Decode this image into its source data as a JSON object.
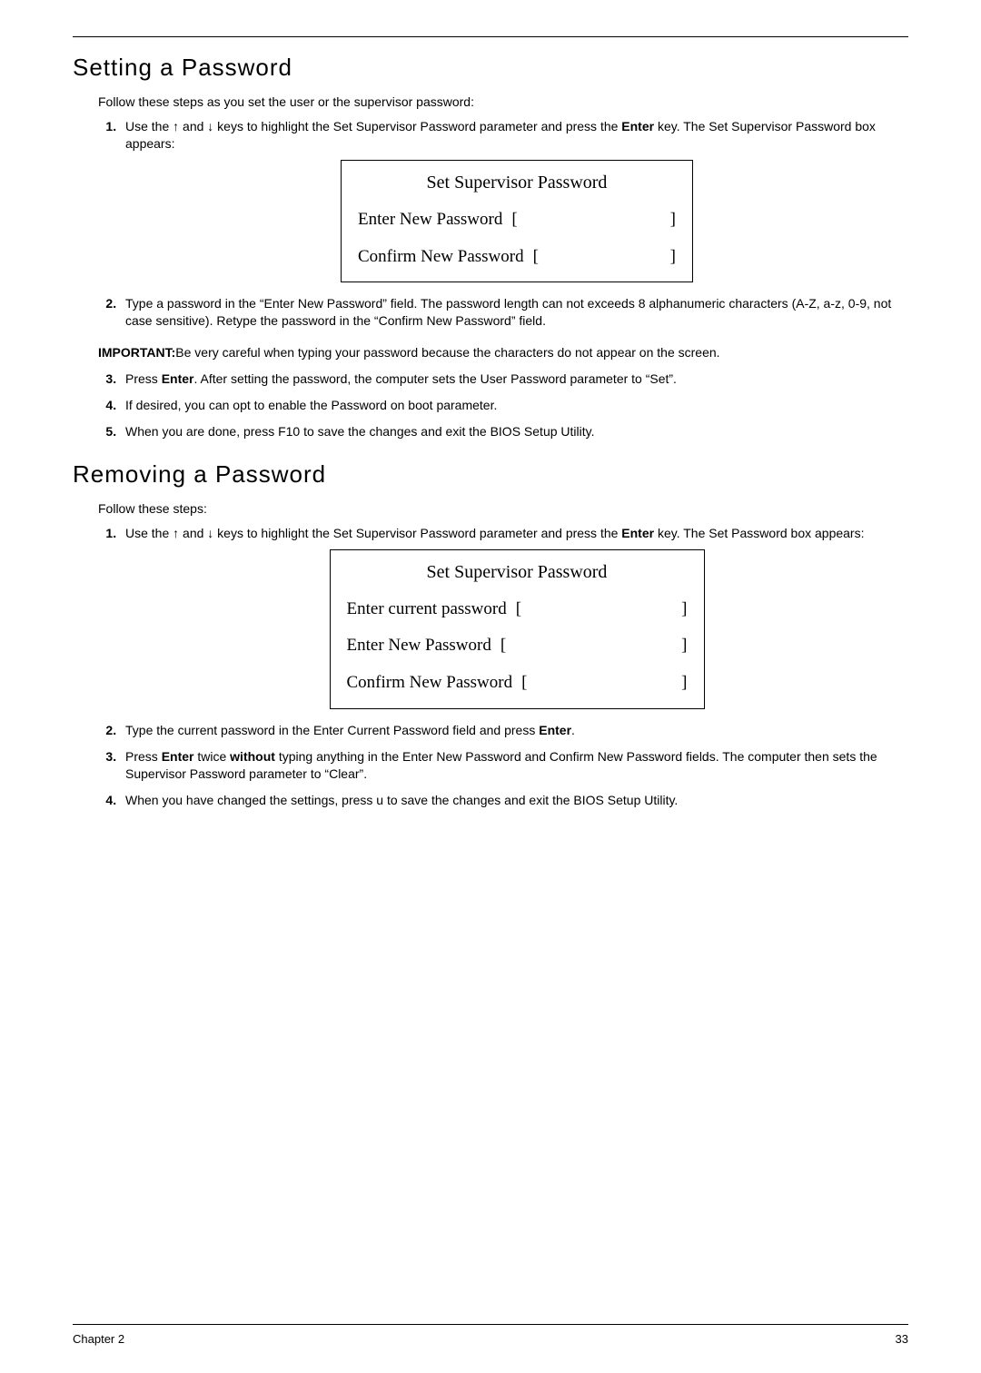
{
  "section1": {
    "heading": "Setting a Password",
    "intro": "Follow these steps as you set the user or the supervisor password:",
    "step1_a": "Use the ",
    "step1_b": " and ",
    "step1_c": " keys to highlight the Set Supervisor Password parameter and press the ",
    "step1_key": "Enter",
    "step1_d": " key. The Set Supervisor Password box appears:",
    "bios": {
      "title": "Set Supervisor Password",
      "row1": "Enter New Password",
      "row2": "Confirm New Password",
      "lb": "[",
      "rb": "]"
    },
    "step2": "Type a password in the “Enter New Password” field. The password length can not exceeds 8 alphanumeric characters (A-Z, a-z, 0-9, not case sensitive). Retype the password in the “Confirm New Password” field.",
    "important_lbl": "IMPORTANT:",
    "important_txt": "Be very careful when typing your password because the characters do not appear on the screen.",
    "step3_a": "Press ",
    "step3_key": "Enter",
    "step3_b": ". After setting the password, the computer sets the User Password parameter to “Set”.",
    "step4": "If desired, you can opt to enable the Password on boot parameter.",
    "step5": "When you are done, press F10 to save the changes and exit the BIOS Setup Utility."
  },
  "section2": {
    "heading": "Removing a Password",
    "intro": "Follow these steps:",
    "step1_a": "Use the ",
    "step1_b": " and ",
    "step1_c": " keys to highlight the Set Supervisor Password parameter and press the ",
    "step1_key": "Enter",
    "step1_d": " key. The Set Password box appears:",
    "bios": {
      "title": "Set Supervisor Password",
      "row1": "Enter current password",
      "row2": "Enter New Password",
      "row3": "Confirm New Password",
      "lb": "[",
      "rb": "]"
    },
    "step2_a": "Type the current password in the Enter Current Password field and press ",
    "step2_key": "Enter",
    "step2_b": ".",
    "step3_a": "Press ",
    "step3_key1": "Enter",
    "step3_b": " twice ",
    "step3_key2": "without",
    "step3_c": " typing anything in the Enter New Password and Confirm New Password fields. The computer then sets the Supervisor Password parameter to “Clear”.",
    "step4": "When you have changed the settings, press u to save the changes and exit the BIOS Setup Utility."
  },
  "arrows": {
    "up": "↑",
    "down": "↓"
  },
  "footer": {
    "chapter": "Chapter 2",
    "page": "33"
  }
}
